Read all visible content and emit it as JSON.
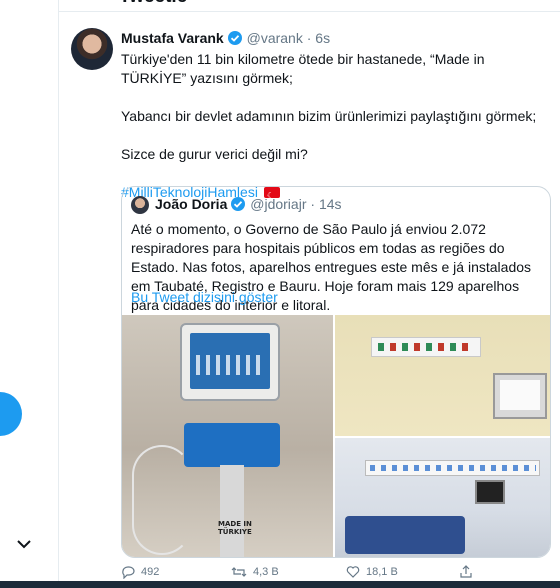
{
  "header": {
    "title": "Tweetle"
  },
  "tweet": {
    "author_name": "Mustafa Varank",
    "handle": "@varank",
    "time": "6s",
    "paragraphs": [
      "Türkiye'den 11 bin kilometre ötede bir hastanede, “Made in TÜRKİYE” yazısını görmek;",
      "Yabancı bir devlet adamının bizim ürünlerimizi paylaştığını görmek;",
      "Sizce de gurur verici değil mi?"
    ],
    "hashtag": "#MilliTeknolojiHamlesi"
  },
  "quote": {
    "author_name": "João Doria",
    "handle": "@jdoriajr",
    "time": "14s",
    "text": "Até o momento, o Governo de São Paulo já enviou 2.072 respiradores para hospitais públicos em todas as regiões do Estado. Nas fotos, aparelhos entregues este mês e já instalados em Taubaté, Registro e Bauru. Hoje foram mais 129 aparelhos para cidades do interior e litoral.",
    "thread_link": "Bu Tweet dizisini göster",
    "stand_label": "MADE IN TÜRKIYE"
  },
  "actions": {
    "replies": "492",
    "retweets": "4,3 B",
    "likes": "18,1 B"
  },
  "colors": {
    "accent": "#1d9bf0",
    "text": "#0f1419",
    "muted": "#657786",
    "border": "#ccd6dd"
  },
  "icons": [
    "verified-icon",
    "reply-icon",
    "retweet-icon",
    "like-icon",
    "share-icon",
    "chevron-down-icon",
    "turkish-flag-icon"
  ]
}
